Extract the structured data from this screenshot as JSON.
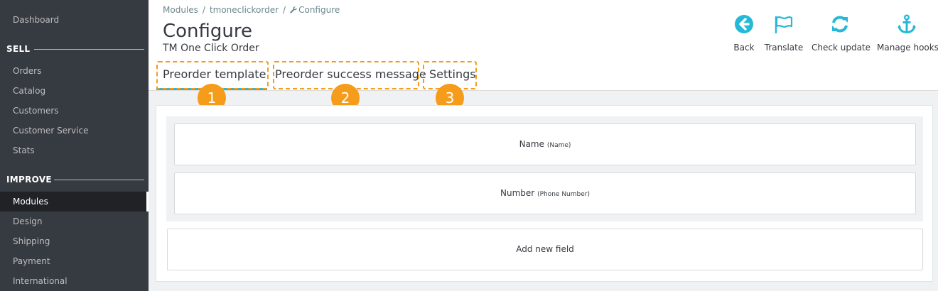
{
  "sidebar": {
    "items": [
      {
        "label": "Dashboard"
      },
      {
        "label": "Orders"
      },
      {
        "label": "Catalog"
      },
      {
        "label": "Customers"
      },
      {
        "label": "Customer Service"
      },
      {
        "label": "Stats"
      },
      {
        "label": "Modules"
      },
      {
        "label": "Design"
      },
      {
        "label": "Shipping"
      },
      {
        "label": "Payment"
      },
      {
        "label": "International"
      }
    ],
    "sections": [
      {
        "label": "SELL"
      },
      {
        "label": "IMPROVE"
      }
    ],
    "active": "Modules"
  },
  "breadcrumb": {
    "items": [
      "Modules",
      "tmoneclickorder",
      "Configure"
    ],
    "separator": "/"
  },
  "header": {
    "title": "Configure",
    "subtitle": "TM One Click Order"
  },
  "toolbar": {
    "back_label": "Back",
    "translate_label": "Translate",
    "check_update_label": "Check update",
    "manage_hooks_label": "Manage hooks"
  },
  "tabs": [
    {
      "label": "Preorder template",
      "active": true,
      "badge": "1"
    },
    {
      "label": "Preorder success message",
      "active": false,
      "badge": "2"
    },
    {
      "label": "Settings",
      "active": false,
      "badge": "3"
    }
  ],
  "fields": [
    {
      "label": "Name",
      "hint": "(Name)"
    },
    {
      "label": "Number",
      "hint": "(Phone Number)"
    }
  ],
  "add_field_label": "Add new field",
  "colors": {
    "sidebar_bg": "#363a41",
    "accent": "#25b9d7",
    "highlight": "#f59c1a"
  },
  "icons": [
    "arrow-circle-left-icon",
    "flag-icon",
    "refresh-icon",
    "anchor-icon",
    "wrench-icon"
  ]
}
